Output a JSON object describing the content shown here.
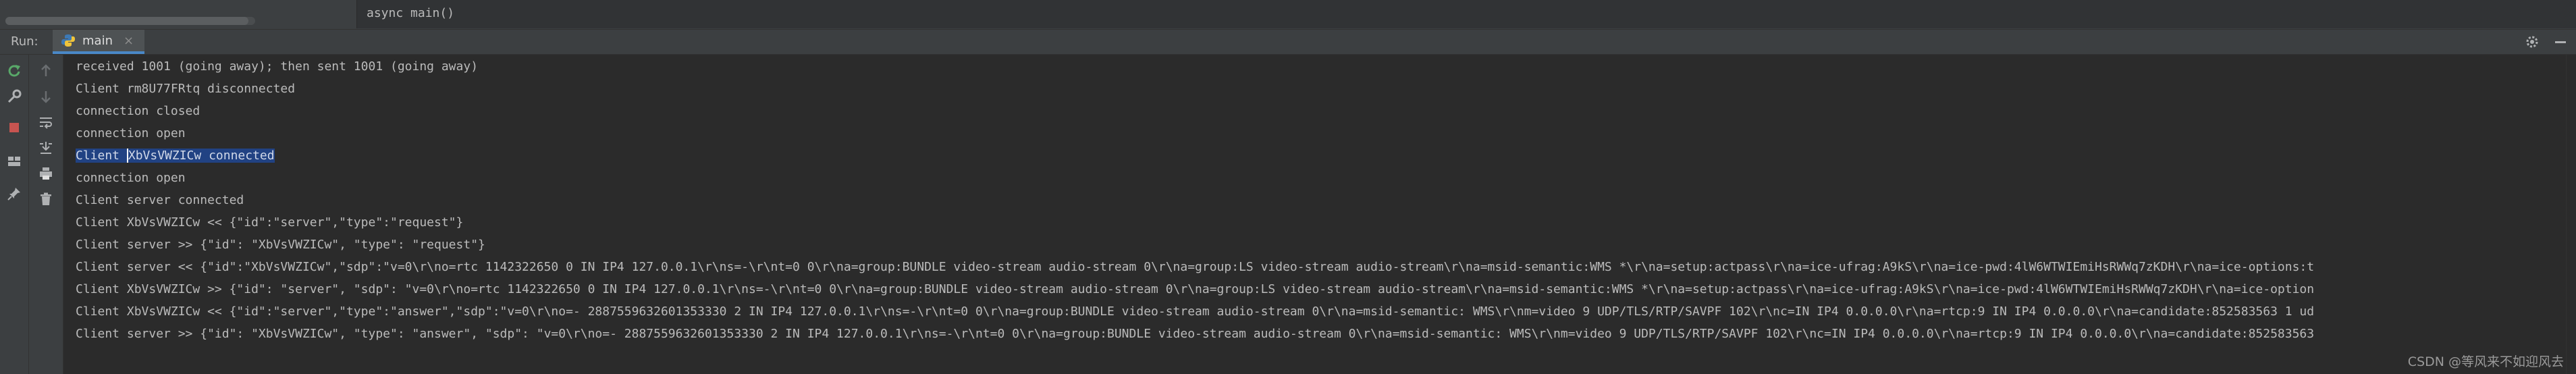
{
  "editor": {
    "breadcrumb": "async main()"
  },
  "run": {
    "label": "Run:",
    "tab_label": "main",
    "tab_close": "×"
  },
  "console": {
    "lines": [
      "received 1001 (going away); then sent 1001 (going away)",
      "Client rm8U77FRtq disconnected",
      "connection closed",
      "connection open",
      "Client XbVsVWZICw connected",
      "connection open",
      "Client server connected",
      "Client XbVsVWZICw << {\"id\":\"server\",\"type\":\"request\"}",
      "Client server >> {\"id\": \"XbVsVWZICw\", \"type\": \"request\"}",
      "Client server << {\"id\":\"XbVsVWZICw\",\"sdp\":\"v=0\\r\\no=rtc 1142322650 0 IN IP4 127.0.0.1\\r\\ns=-\\r\\nt=0 0\\r\\na=group:BUNDLE video-stream audio-stream 0\\r\\na=group:LS video-stream audio-stream\\r\\na=msid-semantic:WMS *\\r\\na=setup:actpass\\r\\na=ice-ufrag:A9kS\\r\\na=ice-pwd:4lW6WTWIEmiHsRWWq7zKDH\\r\\na=ice-options:t",
      "Client XbVsVWZICw >> {\"id\": \"server\", \"sdp\": \"v=0\\r\\no=rtc 1142322650 0 IN IP4 127.0.0.1\\r\\ns=-\\r\\nt=0 0\\r\\na=group:BUNDLE video-stream audio-stream 0\\r\\na=group:LS video-stream audio-stream\\r\\na=msid-semantic:WMS *\\r\\na=setup:actpass\\r\\na=ice-ufrag:A9kS\\r\\na=ice-pwd:4lW6WTWIEmiHsRWWq7zKDH\\r\\na=ice-option",
      "Client XbVsVWZICw << {\"id\":\"server\",\"type\":\"answer\",\"sdp\":\"v=0\\r\\no=- 2887559632601353330 2 IN IP4 127.0.0.1\\r\\ns=-\\r\\nt=0 0\\r\\na=group:BUNDLE video-stream audio-stream 0\\r\\na=msid-semantic: WMS\\r\\nm=video 9 UDP/TLS/RTP/SAVPF 102\\r\\nc=IN IP4 0.0.0.0\\r\\na=rtcp:9 IN IP4 0.0.0.0\\r\\na=candidate:852583563 1 ud",
      "Client server >> {\"id\": \"XbVsVWZICw\", \"type\": \"answer\", \"sdp\": \"v=0\\r\\no=- 2887559632601353330 2 IN IP4 127.0.0.1\\r\\ns=-\\r\\nt=0 0\\r\\na=group:BUNDLE video-stream audio-stream 0\\r\\na=msid-semantic: WMS\\r\\nm=video 9 UDP/TLS/RTP/SAVPF 102\\r\\nc=IN IP4 0.0.0.0\\r\\na=rtcp:9 IN IP4 0.0.0.0\\r\\na=candidate:852583563"
    ],
    "selected_line": {
      "before": "Client ",
      "selected": "XbVsVWZICw connected"
    }
  },
  "watermark": "CSDN @等风来不如迎风去",
  "colors": {
    "background": "#2b2b2b",
    "panel": "#3c3f41",
    "selection": "#214283",
    "tab_underline": "#4a88c7",
    "rerun_green": "#59a869",
    "stop_red": "#c75450"
  },
  "icons": {
    "gear": "gear-icon",
    "minimize": "minimize-icon",
    "rerun": "rerun-icon",
    "wrench": "wrench-icon",
    "stop": "stop-icon",
    "layout": "layout-icon",
    "pin": "pin-icon",
    "up_arrow": "up-arrow-icon",
    "down_arrow": "down-arrow-icon",
    "soft_wrap": "soft-wrap-icon",
    "scroll_end": "scroll-to-end-icon",
    "print": "print-icon",
    "trash": "trash-icon"
  }
}
